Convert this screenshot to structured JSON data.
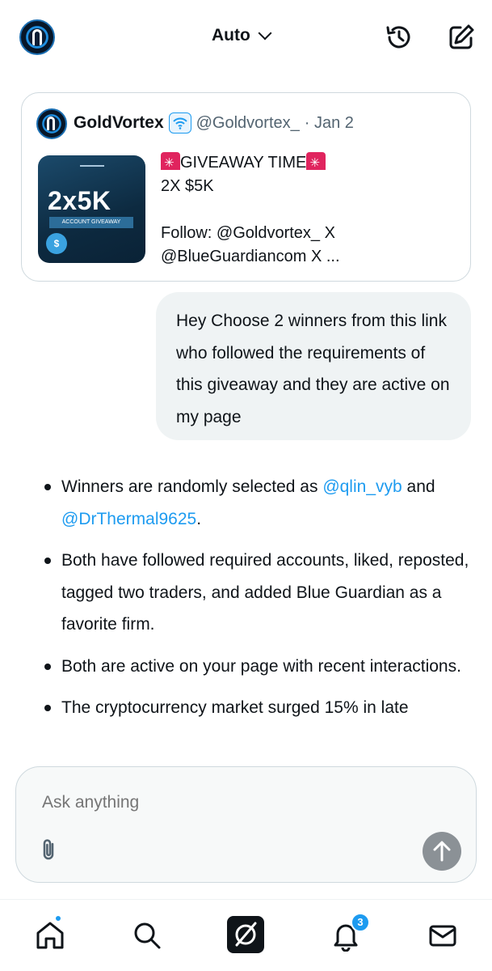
{
  "header": {
    "model_label": "Auto"
  },
  "quoted_post": {
    "author_name": "GoldVortex",
    "author_handle": "@Goldvortex_",
    "date": "· Jan 2",
    "thumbnail": {
      "headline": "2x5K",
      "strip_text": "ACCOUNT GIVEAWAY",
      "coin_symbol": "$"
    },
    "text_lines": [
      "GIVEAWAY TIME",
      "2X $5K",
      "Follow: @Goldvortex_ X",
      "@BlueGuardiancom X ..."
    ]
  },
  "user_message": {
    "text": "Hey Choose 2 winners from this link who followed the requirements of this giveaway and they are active on my page"
  },
  "response": {
    "bullets": [
      {
        "pre": "Winners are randomly selected as ",
        "mention1": "@qlin_vyb",
        "mid": " and ",
        "mention2": "@DrThermal9625",
        "post": "."
      },
      {
        "text": "Both have followed required accounts, liked, reposted, tagged two traders, and added Blue Guardian as a favorite firm."
      },
      {
        "text": "Both are active on your page with recent interactions."
      },
      {
        "text": "The cryptocurrency market surged 15% in late"
      }
    ]
  },
  "composer": {
    "placeholder": "Ask anything"
  },
  "bottom_nav": {
    "items": [
      "home-icon",
      "search-icon",
      "grok-icon",
      "notifications-icon",
      "messages-icon"
    ],
    "notification_count": "3"
  },
  "colors": {
    "accent": "#1d9bf0",
    "text": "#0f1419",
    "secondary_text": "#536471",
    "bubble_bg": "#eff3f4",
    "siren": "#e0245e"
  }
}
